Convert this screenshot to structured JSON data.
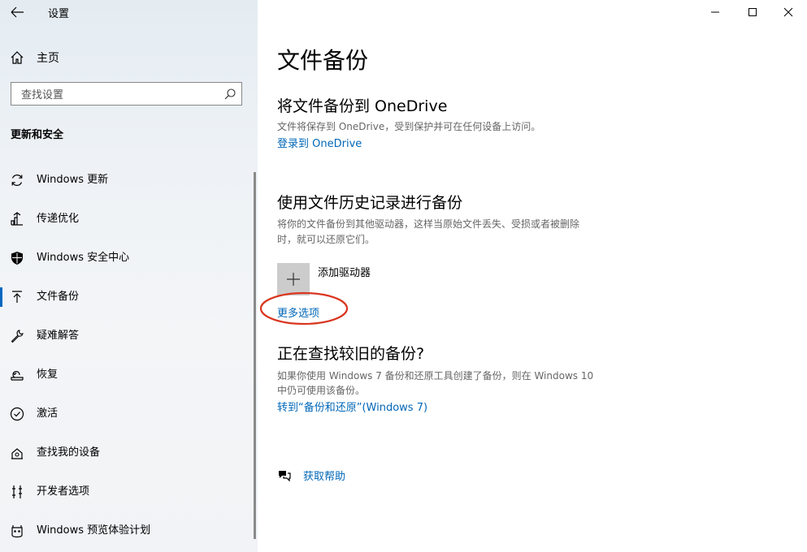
{
  "window": {
    "app_title": "设置",
    "minimize": "minimize",
    "maximize": "maximize",
    "close": "close"
  },
  "sidebar": {
    "home_label": "主页",
    "search_placeholder": "查找设置",
    "section_title": "更新和安全",
    "items": [
      {
        "label": "Windows 更新",
        "icon": "sync-icon"
      },
      {
        "label": "传递优化",
        "icon": "delivery-optimization-icon"
      },
      {
        "label": "Windows 安全中心",
        "icon": "shield-icon"
      },
      {
        "label": "文件备份",
        "icon": "backup-arrow-icon",
        "selected": true
      },
      {
        "label": "疑难解答",
        "icon": "wrench-icon"
      },
      {
        "label": "恢复",
        "icon": "recovery-icon"
      },
      {
        "label": "激活",
        "icon": "check-circle-icon"
      },
      {
        "label": "查找我的设备",
        "icon": "find-device-icon"
      },
      {
        "label": "开发者选项",
        "icon": "developer-icon"
      },
      {
        "label": "Windows 预览体验计划",
        "icon": "insider-icon"
      }
    ]
  },
  "main": {
    "page_title": "文件备份",
    "onedrive": {
      "heading": "将文件备份到 OneDrive",
      "description": "文件将保存到 OneDrive，受到保护并可在任何设备上访问。",
      "link": "登录到 OneDrive"
    },
    "file_history": {
      "heading": "使用文件历史记录进行备份",
      "description_line1": "将你的文件备份到其他驱动器，这样当原始文件丢失、受损或者被删除",
      "description_line2": "时，就可以还原它们。",
      "add_drive_label": "添加驱动器",
      "more_options": "更多选项"
    },
    "older_backup": {
      "heading": "正在查找较旧的备份?",
      "description_line1": "如果你使用 Windows 7 备份和还原工具创建了备份，则在 Windows 10",
      "description_line2": "中仍可使用该备份。",
      "link": "转到“备份和还原”(Windows 7)"
    },
    "help_label": "获取帮助"
  },
  "colors": {
    "accent": "#0067b8",
    "annotation": "#d9361f"
  }
}
